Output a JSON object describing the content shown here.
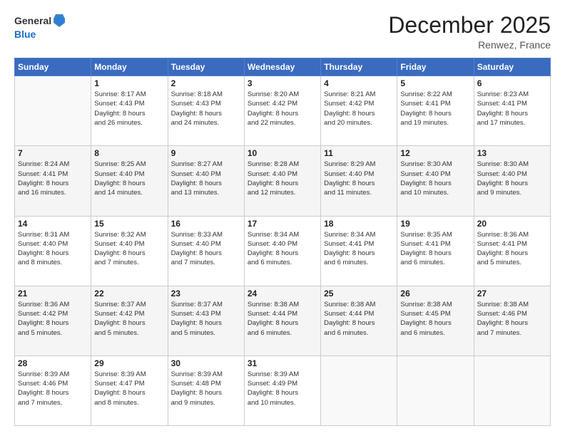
{
  "header": {
    "logo_line1": "General",
    "logo_line2": "Blue",
    "month_title": "December 2025",
    "location": "Renwez, France"
  },
  "weekdays": [
    "Sunday",
    "Monday",
    "Tuesday",
    "Wednesday",
    "Thursday",
    "Friday",
    "Saturday"
  ],
  "weeks": [
    [
      {
        "num": "",
        "info": ""
      },
      {
        "num": "1",
        "info": "Sunrise: 8:17 AM\nSunset: 4:43 PM\nDaylight: 8 hours\nand 26 minutes."
      },
      {
        "num": "2",
        "info": "Sunrise: 8:18 AM\nSunset: 4:43 PM\nDaylight: 8 hours\nand 24 minutes."
      },
      {
        "num": "3",
        "info": "Sunrise: 8:20 AM\nSunset: 4:42 PM\nDaylight: 8 hours\nand 22 minutes."
      },
      {
        "num": "4",
        "info": "Sunrise: 8:21 AM\nSunset: 4:42 PM\nDaylight: 8 hours\nand 20 minutes."
      },
      {
        "num": "5",
        "info": "Sunrise: 8:22 AM\nSunset: 4:41 PM\nDaylight: 8 hours\nand 19 minutes."
      },
      {
        "num": "6",
        "info": "Sunrise: 8:23 AM\nSunset: 4:41 PM\nDaylight: 8 hours\nand 17 minutes."
      }
    ],
    [
      {
        "num": "7",
        "info": "Sunrise: 8:24 AM\nSunset: 4:41 PM\nDaylight: 8 hours\nand 16 minutes."
      },
      {
        "num": "8",
        "info": "Sunrise: 8:25 AM\nSunset: 4:40 PM\nDaylight: 8 hours\nand 14 minutes."
      },
      {
        "num": "9",
        "info": "Sunrise: 8:27 AM\nSunset: 4:40 PM\nDaylight: 8 hours\nand 13 minutes."
      },
      {
        "num": "10",
        "info": "Sunrise: 8:28 AM\nSunset: 4:40 PM\nDaylight: 8 hours\nand 12 minutes."
      },
      {
        "num": "11",
        "info": "Sunrise: 8:29 AM\nSunset: 4:40 PM\nDaylight: 8 hours\nand 11 minutes."
      },
      {
        "num": "12",
        "info": "Sunrise: 8:30 AM\nSunset: 4:40 PM\nDaylight: 8 hours\nand 10 minutes."
      },
      {
        "num": "13",
        "info": "Sunrise: 8:30 AM\nSunset: 4:40 PM\nDaylight: 8 hours\nand 9 minutes."
      }
    ],
    [
      {
        "num": "14",
        "info": "Sunrise: 8:31 AM\nSunset: 4:40 PM\nDaylight: 8 hours\nand 8 minutes."
      },
      {
        "num": "15",
        "info": "Sunrise: 8:32 AM\nSunset: 4:40 PM\nDaylight: 8 hours\nand 7 minutes."
      },
      {
        "num": "16",
        "info": "Sunrise: 8:33 AM\nSunset: 4:40 PM\nDaylight: 8 hours\nand 7 minutes."
      },
      {
        "num": "17",
        "info": "Sunrise: 8:34 AM\nSunset: 4:40 PM\nDaylight: 8 hours\nand 6 minutes."
      },
      {
        "num": "18",
        "info": "Sunrise: 8:34 AM\nSunset: 4:41 PM\nDaylight: 8 hours\nand 6 minutes."
      },
      {
        "num": "19",
        "info": "Sunrise: 8:35 AM\nSunset: 4:41 PM\nDaylight: 8 hours\nand 6 minutes."
      },
      {
        "num": "20",
        "info": "Sunrise: 8:36 AM\nSunset: 4:41 PM\nDaylight: 8 hours\nand 5 minutes."
      }
    ],
    [
      {
        "num": "21",
        "info": "Sunrise: 8:36 AM\nSunset: 4:42 PM\nDaylight: 8 hours\nand 5 minutes."
      },
      {
        "num": "22",
        "info": "Sunrise: 8:37 AM\nSunset: 4:42 PM\nDaylight: 8 hours\nand 5 minutes."
      },
      {
        "num": "23",
        "info": "Sunrise: 8:37 AM\nSunset: 4:43 PM\nDaylight: 8 hours\nand 5 minutes."
      },
      {
        "num": "24",
        "info": "Sunrise: 8:38 AM\nSunset: 4:44 PM\nDaylight: 8 hours\nand 6 minutes."
      },
      {
        "num": "25",
        "info": "Sunrise: 8:38 AM\nSunset: 4:44 PM\nDaylight: 8 hours\nand 6 minutes."
      },
      {
        "num": "26",
        "info": "Sunrise: 8:38 AM\nSunset: 4:45 PM\nDaylight: 8 hours\nand 6 minutes."
      },
      {
        "num": "27",
        "info": "Sunrise: 8:38 AM\nSunset: 4:46 PM\nDaylight: 8 hours\nand 7 minutes."
      }
    ],
    [
      {
        "num": "28",
        "info": "Sunrise: 8:39 AM\nSunset: 4:46 PM\nDaylight: 8 hours\nand 7 minutes."
      },
      {
        "num": "29",
        "info": "Sunrise: 8:39 AM\nSunset: 4:47 PM\nDaylight: 8 hours\nand 8 minutes."
      },
      {
        "num": "30",
        "info": "Sunrise: 8:39 AM\nSunset: 4:48 PM\nDaylight: 8 hours\nand 9 minutes."
      },
      {
        "num": "31",
        "info": "Sunrise: 8:39 AM\nSunset: 4:49 PM\nDaylight: 8 hours\nand 10 minutes."
      },
      {
        "num": "",
        "info": ""
      },
      {
        "num": "",
        "info": ""
      },
      {
        "num": "",
        "info": ""
      }
    ]
  ]
}
